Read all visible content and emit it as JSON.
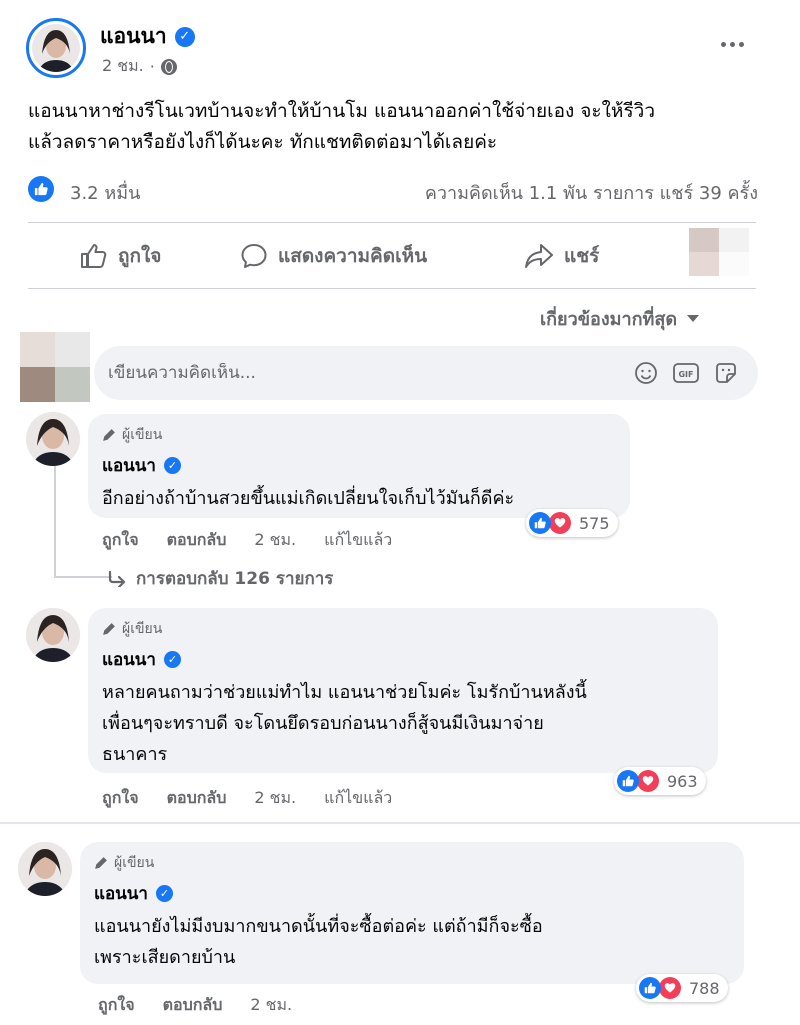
{
  "post": {
    "author": "แอนนา",
    "time": "2 ชม.",
    "text_line1": "แอนนาหาช่างรีโนเวทบ้านจะทำให้บ้านโม แอนนาออกค่าใช้จ่ายเอง จะให้รีวิว",
    "text_line2": "แล้วลดราคาหรือยังไงก็ได้นะคะ ทักแชทติดต่อมาได้เลยค่ะ",
    "likes": "3.2 หมื่น",
    "stats": "ความคิดเห็น 1.1 พัน รายการ  แชร์ 39 ครั้ง"
  },
  "actions": {
    "like": "ถูกใจ",
    "comment": "แสดงความคิดเห็น",
    "share": "แชร์"
  },
  "sort_label": "เกี่ยวข้องมากที่สุด",
  "composer": {
    "placeholder": "เขียนความคิดเห็น...",
    "gif_label": "GIF"
  },
  "comments": [
    {
      "badge": "ผู้เขียน",
      "author": "แอนนา",
      "lines": [
        "อีกอย่างถ้าบ้านสวยขึ้นแม่เกิดเปลี่ยนใจเก็บไว้มันก็ดีค่ะ"
      ],
      "reactions": "575",
      "like": "ถูกใจ",
      "reply": "ตอบกลับ",
      "time": "2 ชม.",
      "edited": "แก้ไขแล้ว",
      "replies_link": "การตอบกลับ 126 รายการ"
    },
    {
      "badge": "ผู้เขียน",
      "author": "แอนนา",
      "lines": [
        "หลายคนถามว่าช่วยแม่ทำไม แอนนาช่วยโมค่ะ โมรักบ้านหลังนี้",
        "เพื่อนๆจะทราบดี จะโดนยึดรอบก่อนนางก็สู้จนมีเงินมาจ่าย",
        "ธนาคาร"
      ],
      "reactions": "963",
      "like": "ถูกใจ",
      "reply": "ตอบกลับ",
      "time": "2 ชม.",
      "edited": "แก้ไขแล้ว"
    },
    {
      "badge": "ผู้เขียน",
      "author": "แอนนา",
      "lines": [
        "แอนนายังไม่มีงบมากขนาดนั้นที่จะซื้อต่อค่ะ แต่ถ้ามีก็จะซื้อ",
        "เพราะเสียดายบ้าน"
      ],
      "reactions": "788",
      "like": "ถูกใจ",
      "reply": "ตอบกลับ",
      "time": "2 ชม."
    }
  ],
  "colors": {
    "brand_blue": "#1877f2",
    "love_red": "#f33e58",
    "muted_text": "#65676b",
    "bubble_bg": "#f0f2f5"
  },
  "icons": [
    "verified-icon",
    "globe-icon",
    "more-icon",
    "like-icon",
    "comment-icon",
    "share-icon",
    "smiley-icon",
    "gif-icon",
    "sticker-icon",
    "pencil-icon",
    "love-icon",
    "reply-arrow-icon",
    "caret-down-icon"
  ]
}
